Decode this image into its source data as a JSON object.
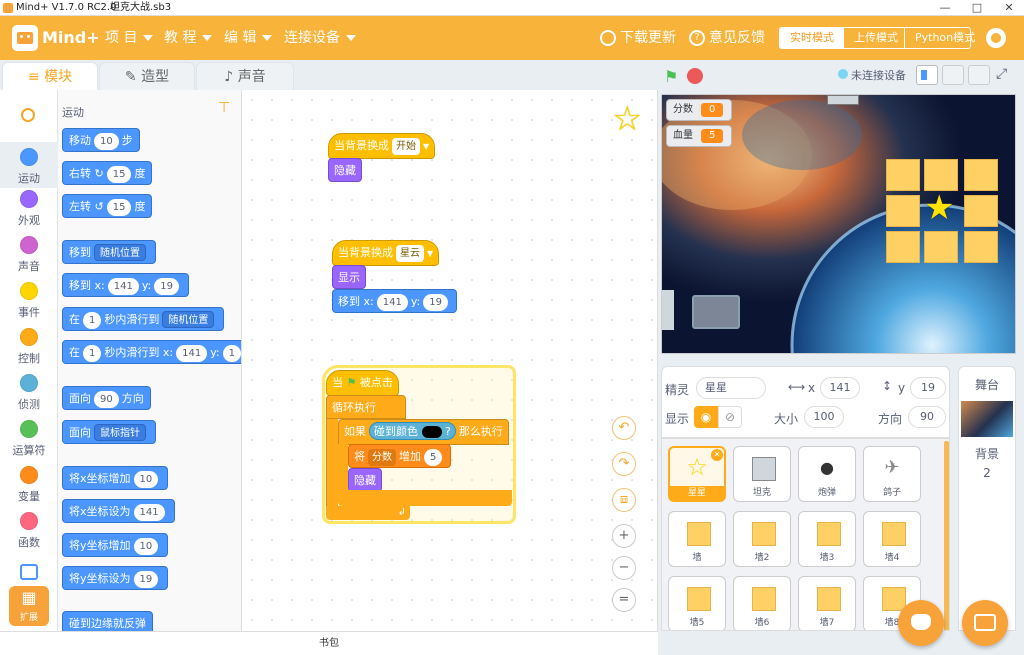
{
  "window": {
    "title": "Mind+ V1.7.0 RC2.0",
    "filename": "坦克大战.sb3"
  },
  "menu": {
    "logo": "Mind+",
    "items": [
      "项 目",
      "教 程",
      "编 辑",
      "连接设备"
    ],
    "download": "下载更新",
    "feedback": "意见反馈",
    "modes": [
      "实时模式",
      "上传模式",
      "Python模式"
    ]
  },
  "tabs": [
    "模块",
    "造型",
    "声音"
  ],
  "categories": [
    {
      "label": "运动",
      "color": "#4c97ff"
    },
    {
      "label": "外观",
      "color": "#9966ff"
    },
    {
      "label": "声音",
      "color": "#cf63cf"
    },
    {
      "label": "事件",
      "color": "#ffd500"
    },
    {
      "label": "控制",
      "color": "#ffab19"
    },
    {
      "label": "侦测",
      "color": "#5cb1d6"
    },
    {
      "label": "运算符",
      "color": "#59c059"
    },
    {
      "label": "变量",
      "color": "#ff8c1a"
    },
    {
      "label": "函数",
      "color": "#ff6680"
    }
  ],
  "extension_label": "扩展",
  "palette": {
    "heading": "运动",
    "move": {
      "pre": "移动",
      "val": "10",
      "post": "步"
    },
    "turn_right": {
      "pre": "右转",
      "val": "15",
      "post": "度"
    },
    "turn_left": {
      "pre": "左转",
      "val": "15",
      "post": "度"
    },
    "goto": {
      "pre": "移到",
      "dd": "随机位置"
    },
    "goto_xy": {
      "pre": "移到 x:",
      "x": "141",
      "ylab": "y:",
      "y": "19"
    },
    "glide": {
      "pre": "在",
      "val": "1",
      "mid": "秒内滑行到",
      "dd": "随机位置"
    },
    "glide_xy": {
      "pre": "在",
      "val": "1",
      "mid": "秒内滑行到 x:",
      "x": "141",
      "ylab": "y:",
      "y": "1"
    },
    "point": {
      "pre": "面向",
      "val": "90",
      "post": "方向"
    },
    "point_towards": {
      "pre": "面向",
      "dd": "鼠标指针"
    },
    "change_x": {
      "pre": "将x坐标增加",
      "val": "10"
    },
    "set_x": {
      "pre": "将x坐标设为",
      "val": "141"
    },
    "change_y": {
      "pre": "将y坐标增加",
      "val": "10"
    },
    "set_y": {
      "pre": "将y坐标设为",
      "val": "19"
    },
    "bounce": "碰到边缘就反弹"
  },
  "script": {
    "s1_hat": "当背景换成",
    "s1_dd": "开始",
    "s1_hide": "隐藏",
    "s2_hat": "当背景换成",
    "s2_dd": "星云",
    "s2_show": "显示",
    "s2_move": "移到 x:",
    "s2_x": "141",
    "s2_ylab": "y:",
    "s2_y": "19",
    "s3_when": "当",
    "s3_clicked": "被点击",
    "s3_forever": "循环执行",
    "s3_if": "如果",
    "s3_touch": "碰到颜色",
    "s3_q": "?",
    "s3_then": "那么执行",
    "s3_change": "将",
    "s3_var": "分数",
    "s3_by": "增加",
    "s3_val": "5",
    "s3_hide": "隐藏"
  },
  "bag": "书包",
  "stage": {
    "status": "未连接设备",
    "monitors": [
      {
        "name": "分数",
        "value": "0"
      },
      {
        "name": "血量",
        "value": "5"
      }
    ]
  },
  "sprite_info": {
    "sprite_label": "精灵",
    "sprite_name": "星星",
    "x_label": "x",
    "x": "141",
    "y_label": "y",
    "y": "19",
    "show_label": "显示",
    "size_label": "大小",
    "size": "100",
    "dir_label": "方向",
    "dir": "90"
  },
  "sprites": [
    "星星",
    "坦克",
    "炮弹",
    "鸽子",
    "墙",
    "墙2",
    "墙3",
    "墙4",
    "墙5",
    "墙6",
    "墙7",
    "墙8"
  ],
  "stage_panel": {
    "title": "舞台",
    "backdrop_label": "背景",
    "backdrop_count": "2"
  }
}
